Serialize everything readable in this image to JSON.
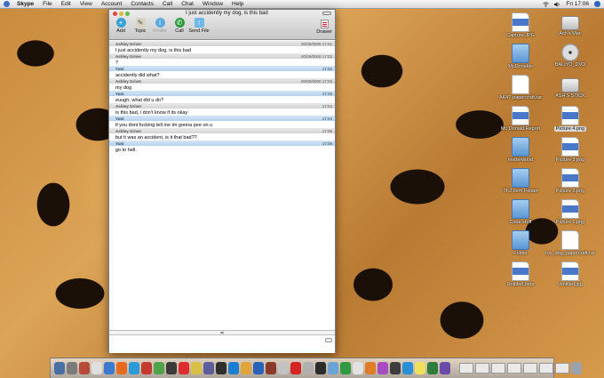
{
  "menubar": {
    "app_name": "Skype",
    "items": [
      "File",
      "Edit",
      "View",
      "Account",
      "Contacts",
      "Call",
      "Chat",
      "Window",
      "Help"
    ],
    "clock": "Fri 17:06"
  },
  "chat_window": {
    "title": "I just accidently my dog, is this bad",
    "toolbar": {
      "add": "Add",
      "topic": "Topic",
      "profile": "Profile",
      "call": "Call",
      "send_file": "Send File",
      "drawer": "Drawer"
    },
    "messages": [
      {
        "sender": "Ashley Griver",
        "time": "00/00/0000 17:01",
        "text": "I just accidently my dog, is this bad",
        "self": false
      },
      {
        "sender": "Ashley Griver",
        "time": "00/00/0000 17:02",
        "text": "?",
        "self": false
      },
      {
        "sender": "Yuni",
        "time": "17:02",
        "text": "accidently did what?",
        "self": true
      },
      {
        "sender": "Ashley Griver",
        "time": "00/00/0000 17:03",
        "text": "my dog",
        "self": false
      },
      {
        "sender": "Yuni",
        "time": "17:03",
        "text": "euugh, what did u do?",
        "self": true
      },
      {
        "sender": "Ashley Griver",
        "time": "17:04",
        "text": "is this bad, i don't know if its okay",
        "self": false
      },
      {
        "sender": "Yuni",
        "time": "17:04",
        "text": "if you dont fucking tell me im gonna pee on u",
        "self": true
      },
      {
        "sender": "Ashley Griver",
        "time": "17:05",
        "text": "but it was an accident, is it that bad??",
        "self": false
      },
      {
        "sender": "Yuni",
        "time": "17:05",
        "text": "go to hell.",
        "self": true
      }
    ]
  },
  "desktop_icons": [
    {
      "name": "Capture.JPG",
      "kind": "image"
    },
    {
      "name": "Ash's Mac",
      "kind": "drive"
    },
    {
      "name": "McDonalds",
      "kind": "folder"
    },
    {
      "name": "BALIYO_DVD",
      "kind": "disc"
    },
    {
      "name": "AK47-papercraft.rar",
      "kind": "file"
    },
    {
      "name": "ASH'S STICK",
      "kind": "drive"
    },
    {
      "name": "Mc Donald Report",
      "kind": "image"
    },
    {
      "name": "Picture 4.png",
      "kind": "image",
      "selected": true
    },
    {
      "name": "matterwood",
      "kind": "folder"
    },
    {
      "name": "Picture 3.png",
      "kind": "image"
    },
    {
      "name": "TF2 Item Folder",
      "kind": "folder"
    },
    {
      "name": "Picture 2.png",
      "kind": "image"
    },
    {
      "name": "Code stuff",
      "kind": "folder"
    },
    {
      "name": "Picture 1.png",
      "kind": "image"
    },
    {
      "name": "Folder",
      "kind": "folder"
    },
    {
      "name": "toy_dog_papercraft.rar",
      "kind": "file"
    },
    {
      "name": "Untitled.bmp",
      "kind": "image"
    },
    {
      "name": "Untitled.jpg",
      "kind": "image"
    }
  ],
  "dock": {
    "app_colors": [
      "#4a6fa5",
      "#7c7c7c",
      "#b84a3a",
      "#dfdfdf",
      "#3c7ad0",
      "#e86a1e",
      "#2a9ad8",
      "#c23b2e",
      "#4fa34a",
      "#3b3b3b",
      "#dc2c2c",
      "#d8c044",
      "#5d5d9c",
      "#2e2e2e",
      "#1a7fd0",
      "#e0a53a",
      "#2a62b8",
      "#8a3a2a",
      "#c2c2c2",
      "#d52424",
      "#b0b0b0",
      "#2b2b2b",
      "#6aa3d6",
      "#2f9a43",
      "#e2e2e2",
      "#de7d25",
      "#a84bc0",
      "#3d3d3d",
      "#2b8fd8",
      "#eee05a",
      "#2c7c3c",
      "#6a4aa8"
    ]
  }
}
